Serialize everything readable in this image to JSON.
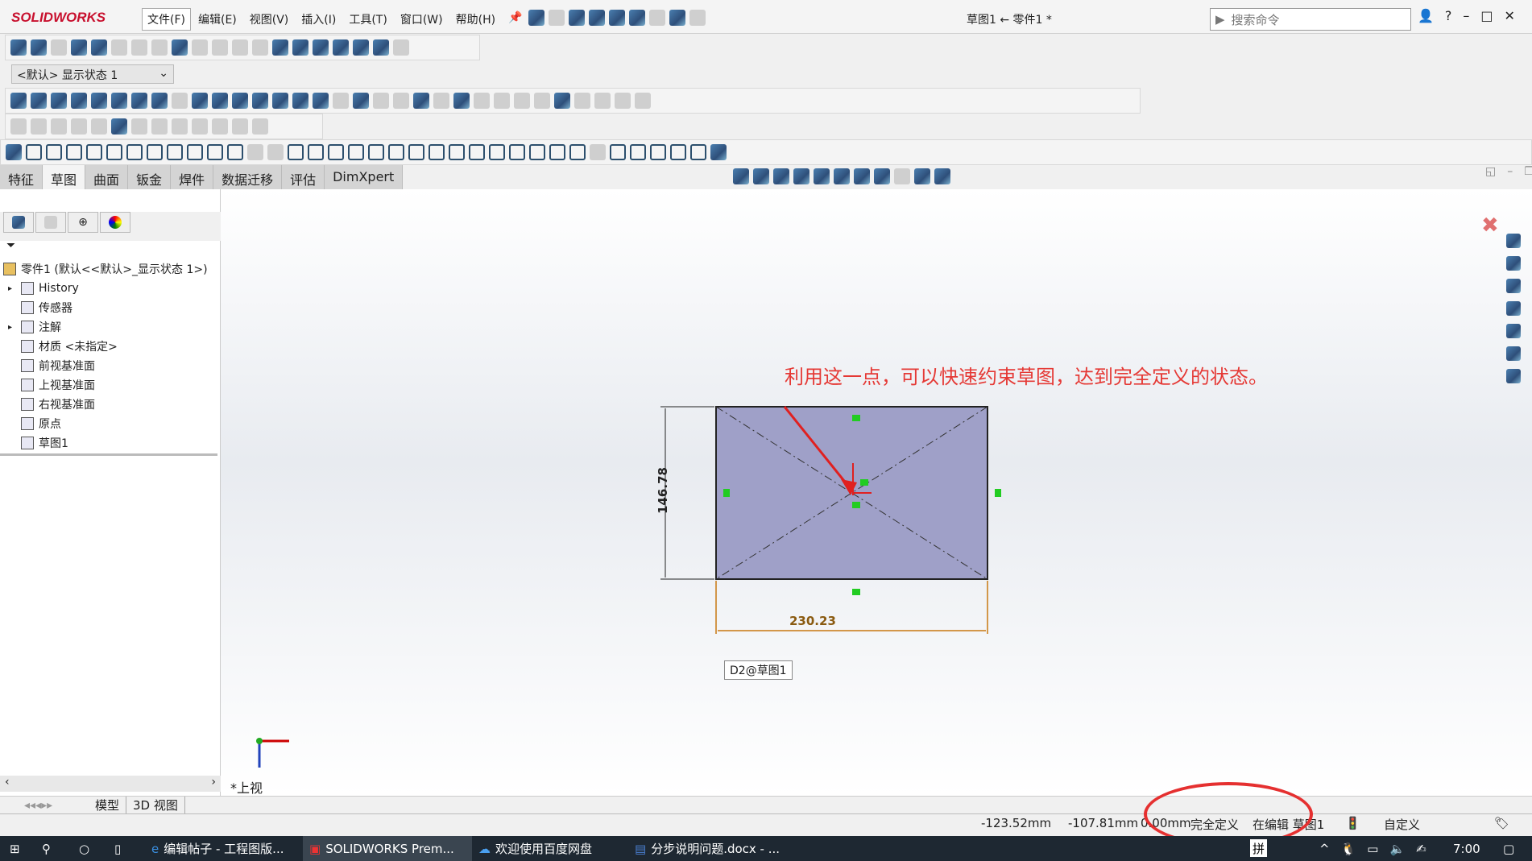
{
  "app": {
    "logo": "SOLIDWORKS",
    "title": "草图1 ← 零件1 *",
    "search_placeholder": "搜索命令"
  },
  "menu": [
    "文件(F)",
    "编辑(E)",
    "视图(V)",
    "插入(I)",
    "工具(T)",
    "窗口(W)",
    "帮助(H)"
  ],
  "toolbar": {
    "display_state": "<默认> 显示状态 1"
  },
  "tabs": [
    "特征",
    "草图",
    "曲面",
    "钣金",
    "焊件",
    "数据迁移",
    "评估",
    "DimXpert"
  ],
  "active_tab": "草图",
  "tree": {
    "root": "零件1  (默认<<默认>_显示状态 1>)",
    "items": [
      {
        "label": "History",
        "icon": "history-icon",
        "expand": true
      },
      {
        "label": "传感器",
        "icon": "sensor-icon"
      },
      {
        "label": "注解",
        "icon": "annotation-icon",
        "expand": true
      },
      {
        "label": "材质 <未指定>",
        "icon": "material-icon"
      },
      {
        "label": "前视基准面",
        "icon": "plane-icon"
      },
      {
        "label": "上视基准面",
        "icon": "plane-icon"
      },
      {
        "label": "右视基准面",
        "icon": "plane-icon"
      },
      {
        "label": "原点",
        "icon": "origin-icon"
      },
      {
        "label": "草图1",
        "icon": "sketch-icon"
      }
    ]
  },
  "sketch": {
    "annotation": "利用这一点，可以快速约束草图，达到完全定义的状态。",
    "dim_vertical": "146.78",
    "dim_horizontal": "230.23",
    "dim_tag": "D2@草图1",
    "view_label": "*上视",
    "fill": "#9fa0c8",
    "annotation_color": "#e53935"
  },
  "bottom_tabs": [
    "模型",
    "3D 视图"
  ],
  "status": {
    "x": "-123.52mm",
    "y": "-107.81mm",
    "z": "0.00mm",
    "state": "完全定义",
    "editing": "在编辑 草图1",
    "units": "自定义"
  },
  "taskbar": {
    "items": [
      "编辑帖子 - 工程图版...",
      "SOLIDWORKS Prem...",
      "欢迎使用百度网盘",
      "分步说明问题.docx - ..."
    ],
    "ime": "拼",
    "time": "7:00"
  }
}
